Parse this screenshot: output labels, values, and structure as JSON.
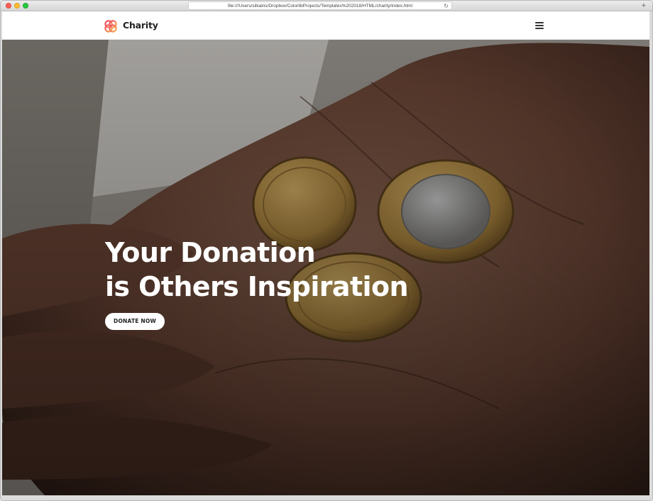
{
  "browser": {
    "url": "file:///Users/silkalns/Dropbox/ColorlibProjects/Templates%202018/HTML/charity/index.html",
    "reload_icon": "reload-icon",
    "new_tab_icon": "plus-icon"
  },
  "navbar": {
    "brand": "Charity",
    "logo_icon": "charity-logo-icon",
    "menu_icon": "hamburger-menu-icon"
  },
  "hero": {
    "title_line1": "Your Donation",
    "title_line2": "is Others Inspiration",
    "cta_label": "DONATE NOW"
  },
  "colors": {
    "logo_gradient": [
      "#f0456a",
      "#f8b24a"
    ],
    "button_bg": "#ffffff",
    "hero_text": "#ffffff"
  }
}
